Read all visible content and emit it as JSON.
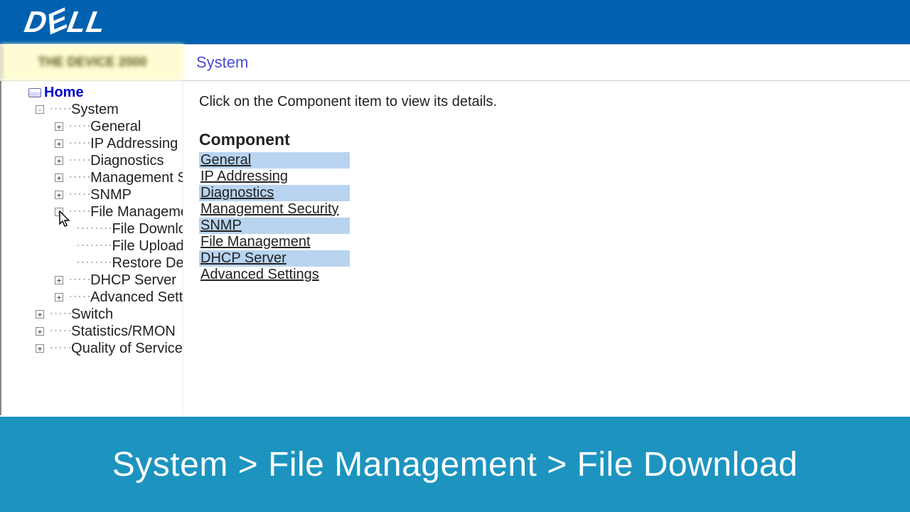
{
  "header": {
    "logo_text": "DELL"
  },
  "topbar": {
    "device_label": "THE DEVICE 2000",
    "title": "System"
  },
  "tree": {
    "home": "Home",
    "system": "System",
    "system_children": [
      "General",
      "IP Addressing",
      "Diagnostics",
      "Management Se",
      "SNMP",
      "File Managemer"
    ],
    "file_mgmt_children": [
      "File Downloa",
      "File Upload",
      "Restore Defa"
    ],
    "system_after": [
      "DHCP Server",
      "Advanced Settin"
    ],
    "root_after": [
      "Switch",
      "Statistics/RMON",
      "Quality of Service"
    ]
  },
  "main": {
    "instruction": "Click on the Component item to view its details.",
    "component_header": "Component",
    "components": [
      "General",
      "IP Addressing",
      "Diagnostics",
      "Management Security",
      "SNMP",
      "File Management",
      "DHCP Server",
      "Advanced Settings"
    ]
  },
  "footer": {
    "breadcrumb": "System > File Management > File Download"
  }
}
